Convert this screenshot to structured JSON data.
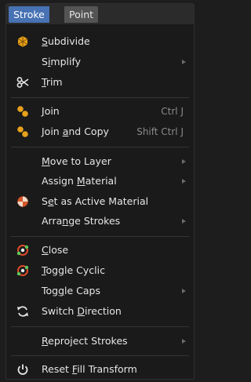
{
  "tabs": [
    {
      "label": "Stroke"
    },
    {
      "label": "Point"
    }
  ],
  "menu_items": [
    {
      "pre": "",
      "u": "S",
      "post": "ubdivide",
      "icon": "subdivide-icon"
    },
    {
      "pre": "S",
      "u": "i",
      "post": "mplify",
      "submenu": true
    },
    {
      "pre": "",
      "u": "T",
      "post": "rim",
      "icon": "scissors-icon"
    },
    {
      "pre": "",
      "u": "J",
      "post": "oin",
      "shortcut": "Ctrl J",
      "icon": "join-icon"
    },
    {
      "pre": "Join ",
      "u": "a",
      "post": "nd Copy",
      "shortcut": "Shift Ctrl J",
      "icon": "join-icon"
    },
    {
      "pre": "",
      "u": "M",
      "post": "ove to Layer",
      "submenu": true
    },
    {
      "pre": "Assign ",
      "u": "M",
      "post": "aterial",
      "submenu": true
    },
    {
      "pre": "S",
      "u": "e",
      "post": "t as Active Material",
      "icon": "material-icon"
    },
    {
      "pre": "Arra",
      "u": "n",
      "post": "ge Strokes",
      "submenu": true
    },
    {
      "pre": "",
      "u": "C",
      "post": "lose",
      "icon": "close-cyclic-icon"
    },
    {
      "pre": "",
      "u": "T",
      "post": "oggle Cyclic",
      "icon": "close-cyclic-icon"
    },
    {
      "pre": "Tog",
      "u": "g",
      "post": "le Caps",
      "submenu": true
    },
    {
      "pre": "Switch ",
      "u": "D",
      "post": "irection",
      "icon": "switch-direction-icon"
    },
    {
      "pre": "",
      "u": "R",
      "post": "eproject Strokes",
      "submenu": true
    },
    {
      "pre": "Reset ",
      "u": "F",
      "post": "ill Transform",
      "icon": "power-icon"
    }
  ]
}
